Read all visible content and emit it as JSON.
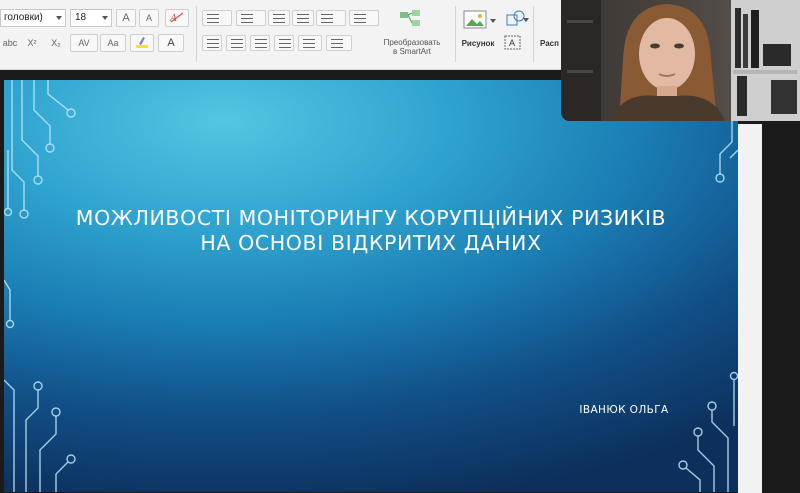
{
  "ribbon": {
    "font_name": "головки)",
    "font_size": "18",
    "grow_font_glyph": "A",
    "shrink_font_glyph": "A",
    "strike_label": "abc",
    "superscript_label": "X²",
    "subscript_label": "X₂",
    "spacing_label": "AV",
    "case_label": "Aa",
    "font_color_glyph": "A",
    "smartart_label": "Преобразовать\nв SmartArt",
    "picture_label": "Рисунок",
    "arrange_label": "Расп"
  },
  "slide": {
    "title_line1": "МОЖЛИВОСТІ МОНІТОРИНГУ КОРУПЦІЙНИХ РИЗИКІВ",
    "title_line2": "НА ОСНОВІ ВІДКРИТИХ ДАНИХ",
    "author": "ІВАНЮК ОЛЬГА"
  },
  "colors": {
    "slide_gradient_light": "#52c6e2",
    "slide_gradient_dark": "#0d2f5c",
    "circuit_line": "#bfe9f6"
  }
}
